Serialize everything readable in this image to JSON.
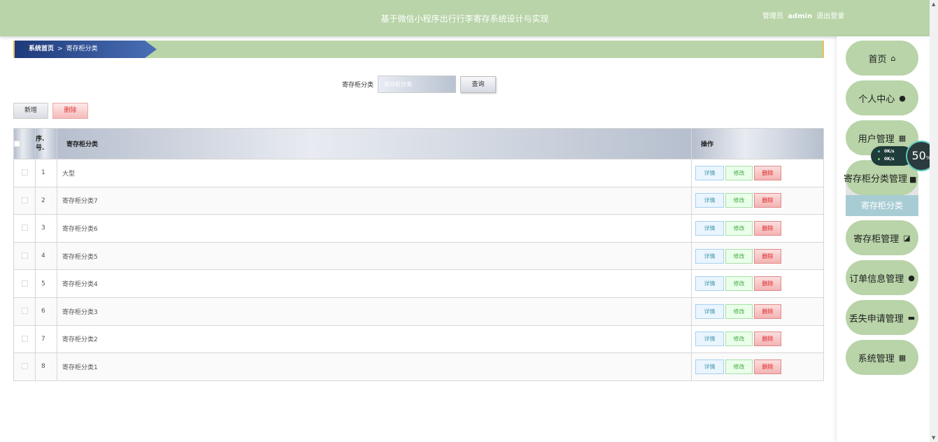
{
  "header": {
    "title": "基于微信小程序出行行李寄存系统设计与实现",
    "role": "管理员",
    "username": "admin",
    "logout": "退出登录"
  },
  "breadcrumb": {
    "home": "系统首页",
    "separator": ">",
    "current": "寄存柜分类"
  },
  "search": {
    "label": "寄存柜分类",
    "placeholder": "寄存柜分类",
    "button": "查询"
  },
  "toolbar": {
    "add": "新增",
    "delete": "删除"
  },
  "table": {
    "columns": [
      "序号",
      "寄存柜分类",
      "操作"
    ],
    "index_header_line1": "序.",
    "index_header_line2": "号.",
    "rows": [
      {
        "index": "1",
        "name": "大型"
      },
      {
        "index": "2",
        "name": "寄存柜分类7"
      },
      {
        "index": "3",
        "name": "寄存柜分类6"
      },
      {
        "index": "4",
        "name": "寄存柜分类5"
      },
      {
        "index": "5",
        "name": "寄存柜分类4"
      },
      {
        "index": "6",
        "name": "寄存柜分类3"
      },
      {
        "index": "7",
        "name": "寄存柜分类2"
      },
      {
        "index": "8",
        "name": "寄存柜分类1"
      }
    ],
    "row_actions": {
      "detail": "详情",
      "edit": "修改",
      "delete": "删除"
    }
  },
  "sidebar": {
    "items": [
      {
        "label": "首页",
        "icon": "home-icon",
        "glyph": "⌂"
      },
      {
        "label": "个人中心",
        "icon": "user-icon",
        "glyph": "👤"
      },
      {
        "label": "用户管理",
        "icon": "grid-icon",
        "glyph": "▦"
      },
      {
        "label": "寄存柜分类管理",
        "icon": "square-icon",
        "glyph": "■"
      },
      {
        "label": "寄存柜管理",
        "icon": "chart-icon",
        "glyph": "◪"
      },
      {
        "label": "订单信息管理",
        "icon": "user-icon",
        "glyph": "👤"
      },
      {
        "label": "丢失申请管理",
        "icon": "briefcase-icon",
        "glyph": "▬"
      },
      {
        "label": "系统管理",
        "icon": "grid-icon",
        "glyph": "▦"
      }
    ],
    "sub_item": "寄存柜分类"
  },
  "speed_widget": {
    "upload": "0K/s",
    "download": "0K/s",
    "percent": "50",
    "unit": "%"
  },
  "colors": {
    "header_bg": "#b8d4a8",
    "breadcrumb_accent": "#1e3a7a",
    "sub_item_bg": "#a8ccd4",
    "delete_red": "#d22222"
  }
}
